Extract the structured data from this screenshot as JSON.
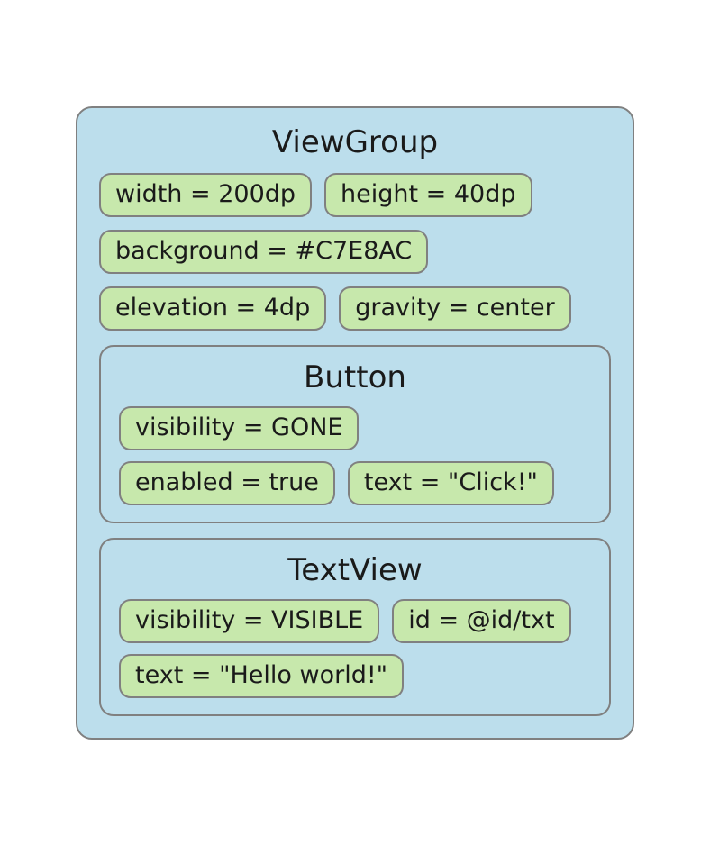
{
  "viewgroup": {
    "title": "ViewGroup",
    "props": {
      "width": "width = 200dp",
      "height": "height = 40dp",
      "background": "background = #C7E8AC",
      "elevation": "elevation = 4dp",
      "gravity": "gravity = center"
    },
    "children": [
      {
        "title": "Button",
        "props": {
          "visibility": "visibility = GONE",
          "enabled": "enabled = true",
          "text": "text = \"Click!\""
        }
      },
      {
        "title": "TextView",
        "props": {
          "visibility": "visibility = VISIBLE",
          "id": "id = @id/txt",
          "text": "text = \"Hello world!\""
        }
      }
    ]
  }
}
